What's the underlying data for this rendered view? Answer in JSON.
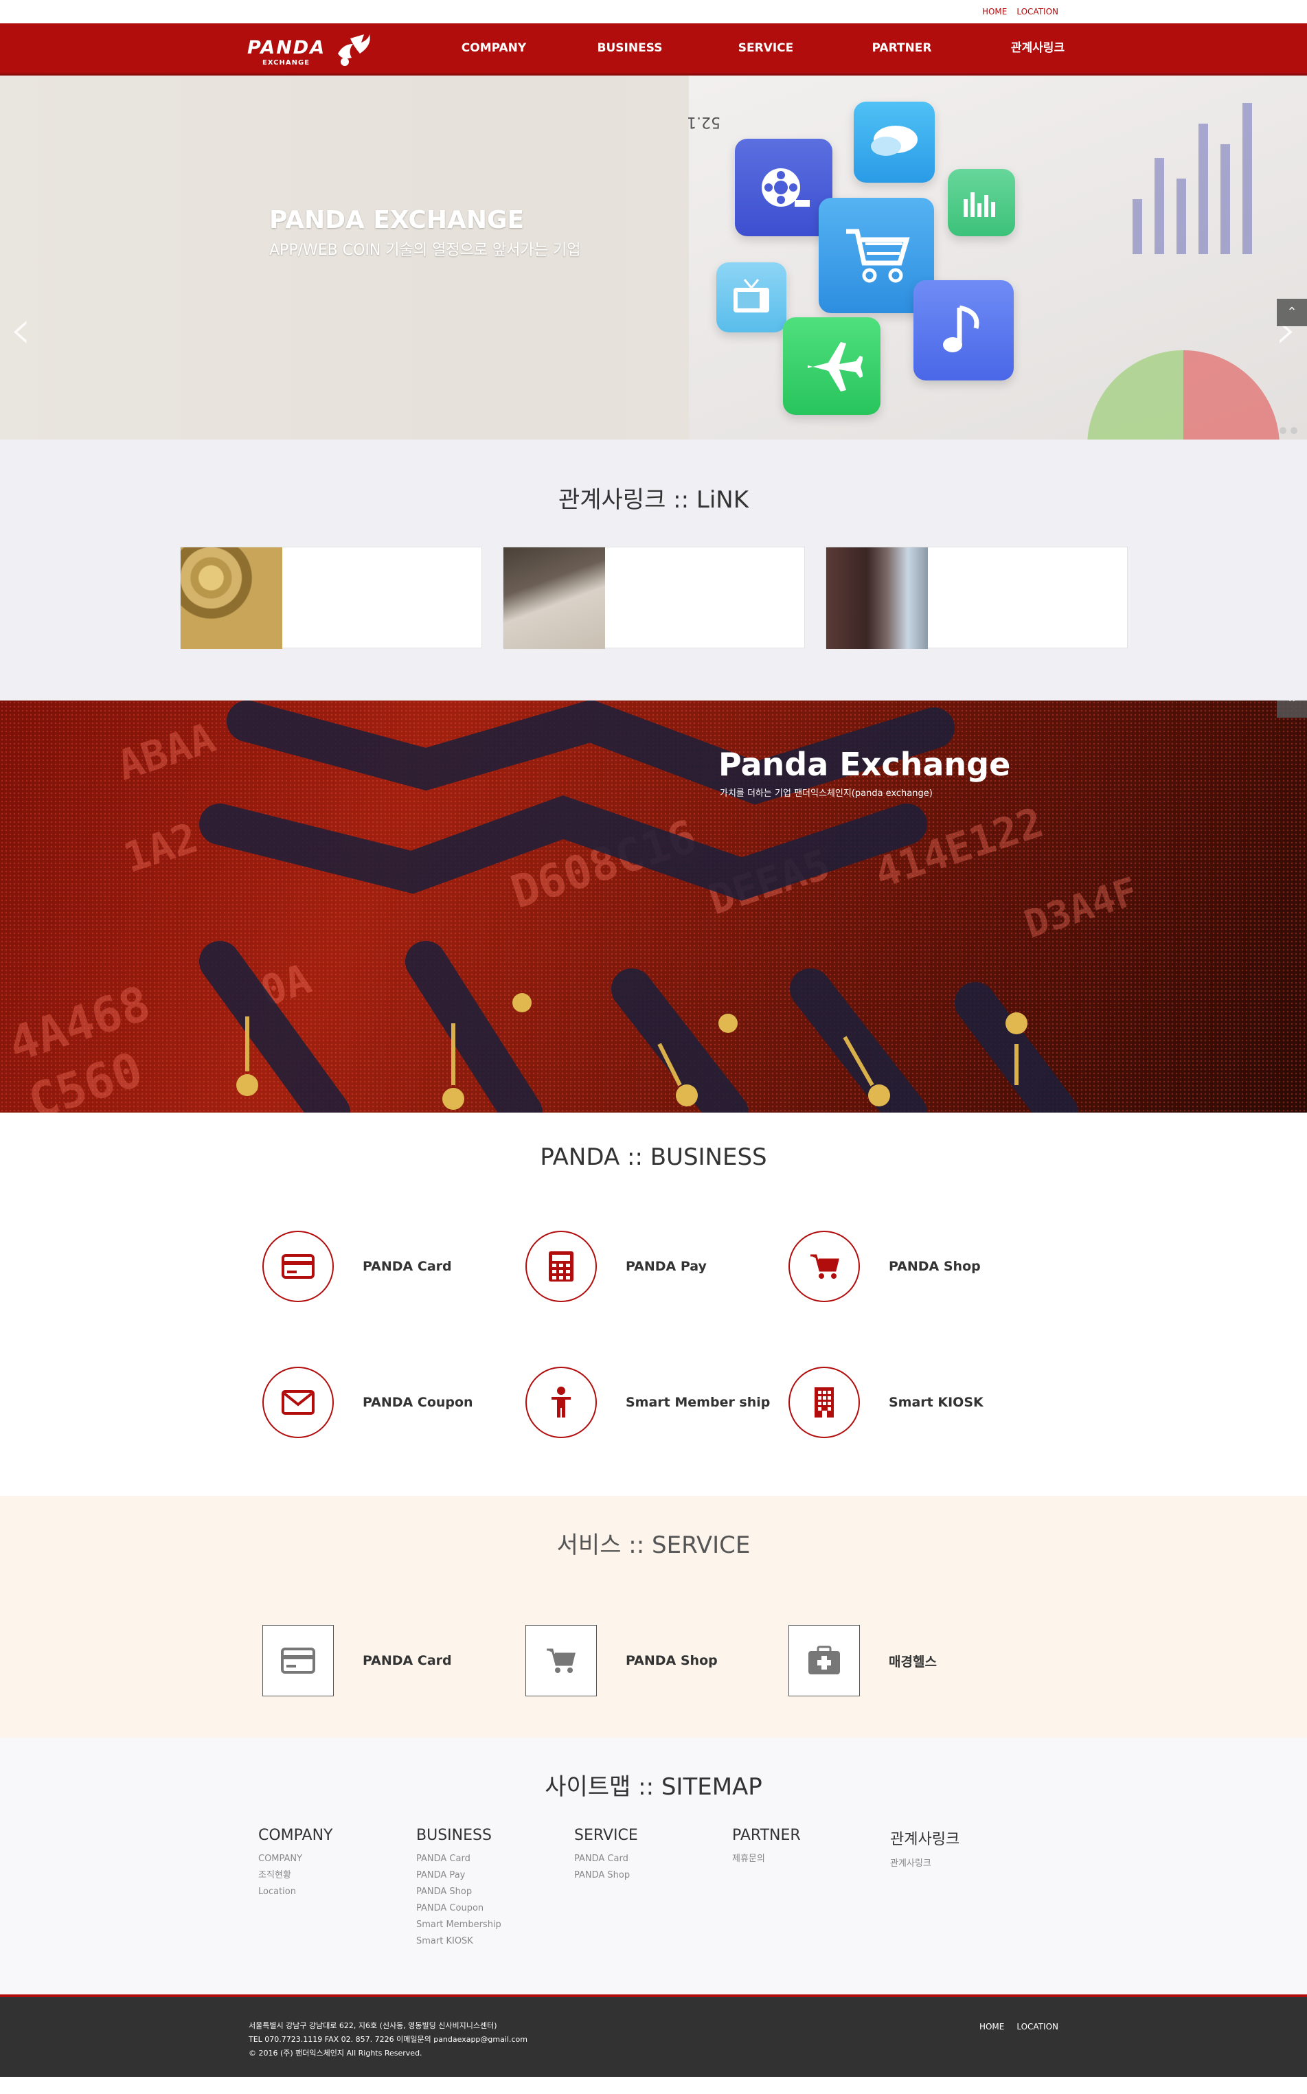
{
  "util_links": {
    "home": "HOME",
    "location": "LOCATION"
  },
  "brand": {
    "name": "PANDA",
    "sub": "EXCHANGE"
  },
  "nav": {
    "items": [
      "COMPANY",
      "BUSINESS",
      "SERVICE",
      "PARTNER",
      "관계사링크"
    ]
  },
  "hero": {
    "title": "PANDA EXCHANGE",
    "subtitle": "APP/WEB COIN 기술의 열정으로 앞서가는 기업",
    "paper_text": "52.1",
    "prev_arrow": "‹",
    "next_arrow": "›",
    "to_top": "⌃",
    "slides": 2
  },
  "link_section": {
    "title": "관계사링크 :: LiNK"
  },
  "banner": {
    "title": "Panda Exchange",
    "subtitle": "가치를 더하는 기업 팬더익스체인지(panda exchange)",
    "hex_text": [
      "ABAA",
      "4A468",
      "C560",
      "D608C16",
      "DEEA5",
      "414E122",
      "D3A4F",
      "0A",
      "1A2"
    ]
  },
  "business": {
    "title": "PANDA :: BUSINESS",
    "items": [
      {
        "label": "PANDA Card",
        "icon": "credit-card-icon"
      },
      {
        "label": "PANDA Pay",
        "icon": "calculator-icon"
      },
      {
        "label": "PANDA Shop",
        "icon": "cart-icon"
      },
      {
        "label": "PANDA Coupon",
        "icon": "envelope-icon"
      },
      {
        "label": "Smart Member ship",
        "icon": "person-icon"
      },
      {
        "label": "Smart KIOSK",
        "icon": "building-icon"
      }
    ]
  },
  "service": {
    "title": "서비스 :: SERVICE",
    "items": [
      {
        "label": "PANDA Card",
        "icon": "credit-card-icon"
      },
      {
        "label": "PANDA Shop",
        "icon": "cart-icon"
      },
      {
        "label": "매경헬스",
        "icon": "medical-kit-icon"
      }
    ]
  },
  "sitemap": {
    "title": "사이트맵 :: SITEMAP",
    "columns": [
      {
        "heading": "COMPANY",
        "items": [
          "COMPANY",
          "조직현황",
          "Location"
        ]
      },
      {
        "heading": "BUSINESS",
        "items": [
          "PANDA Card",
          "PANDA Pay",
          "PANDA Shop",
          "PANDA Coupon",
          "Smart Membership",
          "Smart KIOSK"
        ]
      },
      {
        "heading": "SERVICE",
        "items": [
          "PANDA Card",
          "PANDA Shop"
        ]
      },
      {
        "heading": "PARTNER",
        "items": [
          "제휴문의"
        ]
      },
      {
        "heading": "관계사링크",
        "items": [
          "관계사링크"
        ]
      }
    ]
  },
  "footer": {
    "address": "서울특별시 강남구 강남대로 622, 지6호 (신사동, 영동빌딩 신사비지니스센터)",
    "contact": "TEL 070.7723.1119 FAX 02. 857. 7226 이메일문의 pandaexapp@gmail.com",
    "copyright": "© 2016 (주) 팬더익스체인지 All Rights Reserved.",
    "links": [
      "HOME",
      "LOCATION"
    ]
  },
  "colors": {
    "primary": "#b10d0d",
    "footer": "#323232",
    "service_bg": "#fdf5ec"
  }
}
